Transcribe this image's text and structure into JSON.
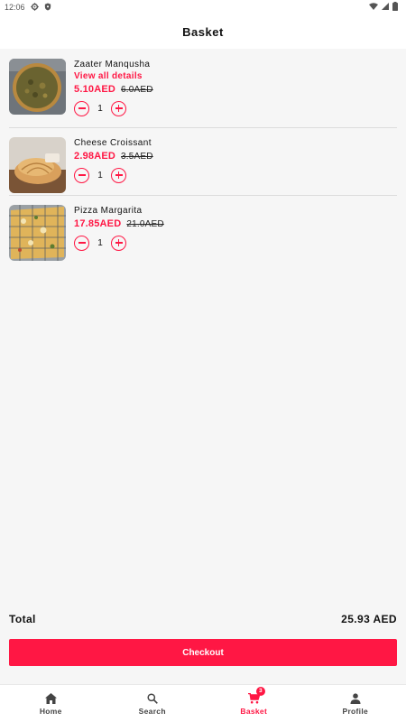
{
  "status_bar": {
    "time": "12:06"
  },
  "header": {
    "title": "Basket"
  },
  "items": [
    {
      "name": "Zaater Manqusha",
      "details_link": "View all details",
      "price": "5.10AED",
      "old_price": "6.0AED",
      "quantity": "1",
      "image_icon": "zaater-manqusha-photo"
    },
    {
      "name": "Cheese Croissant",
      "price": "2.98AED",
      "old_price": "3.5AED",
      "quantity": "1",
      "image_icon": "cheese-croissant-photo"
    },
    {
      "name": "Pizza Margarita",
      "price": "17.85AED",
      "old_price": "21.0AED",
      "quantity": "1",
      "image_icon": "pizza-margarita-photo"
    }
  ],
  "summary": {
    "total_label": "Total",
    "total_value": "25.93 AED"
  },
  "checkout": {
    "label": "Checkout"
  },
  "bottom_nav": {
    "items": [
      {
        "label": "Home",
        "icon": "home-icon"
      },
      {
        "label": "Search",
        "icon": "search-icon"
      },
      {
        "label": "Basket",
        "icon": "cart-icon",
        "badge": "3",
        "active": true
      },
      {
        "label": "Profile",
        "icon": "person-icon"
      }
    ]
  },
  "colors": {
    "accent": "#ff1744",
    "background": "#f6f6f6",
    "surface": "#ffffff"
  }
}
